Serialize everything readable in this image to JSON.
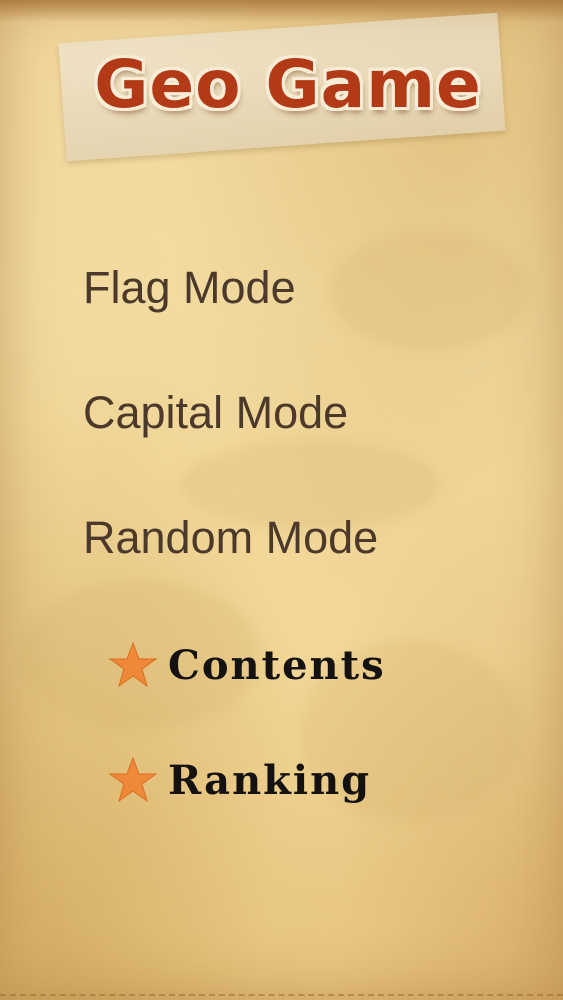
{
  "header": {
    "title": "Geo Game"
  },
  "menu": {
    "items": [
      {
        "label": "Flag Mode"
      },
      {
        "label": "Capital Mode"
      },
      {
        "label": "Random Mode"
      }
    ]
  },
  "links": {
    "contents": {
      "label": "Contents",
      "icon": "star-icon"
    },
    "ranking": {
      "label": "Ranking",
      "icon": "star-icon"
    }
  },
  "colors": {
    "title": "#b23a17",
    "menu_text": "#4b3a2b",
    "star": "#f0883a",
    "parchment": "#f6e0a8"
  }
}
